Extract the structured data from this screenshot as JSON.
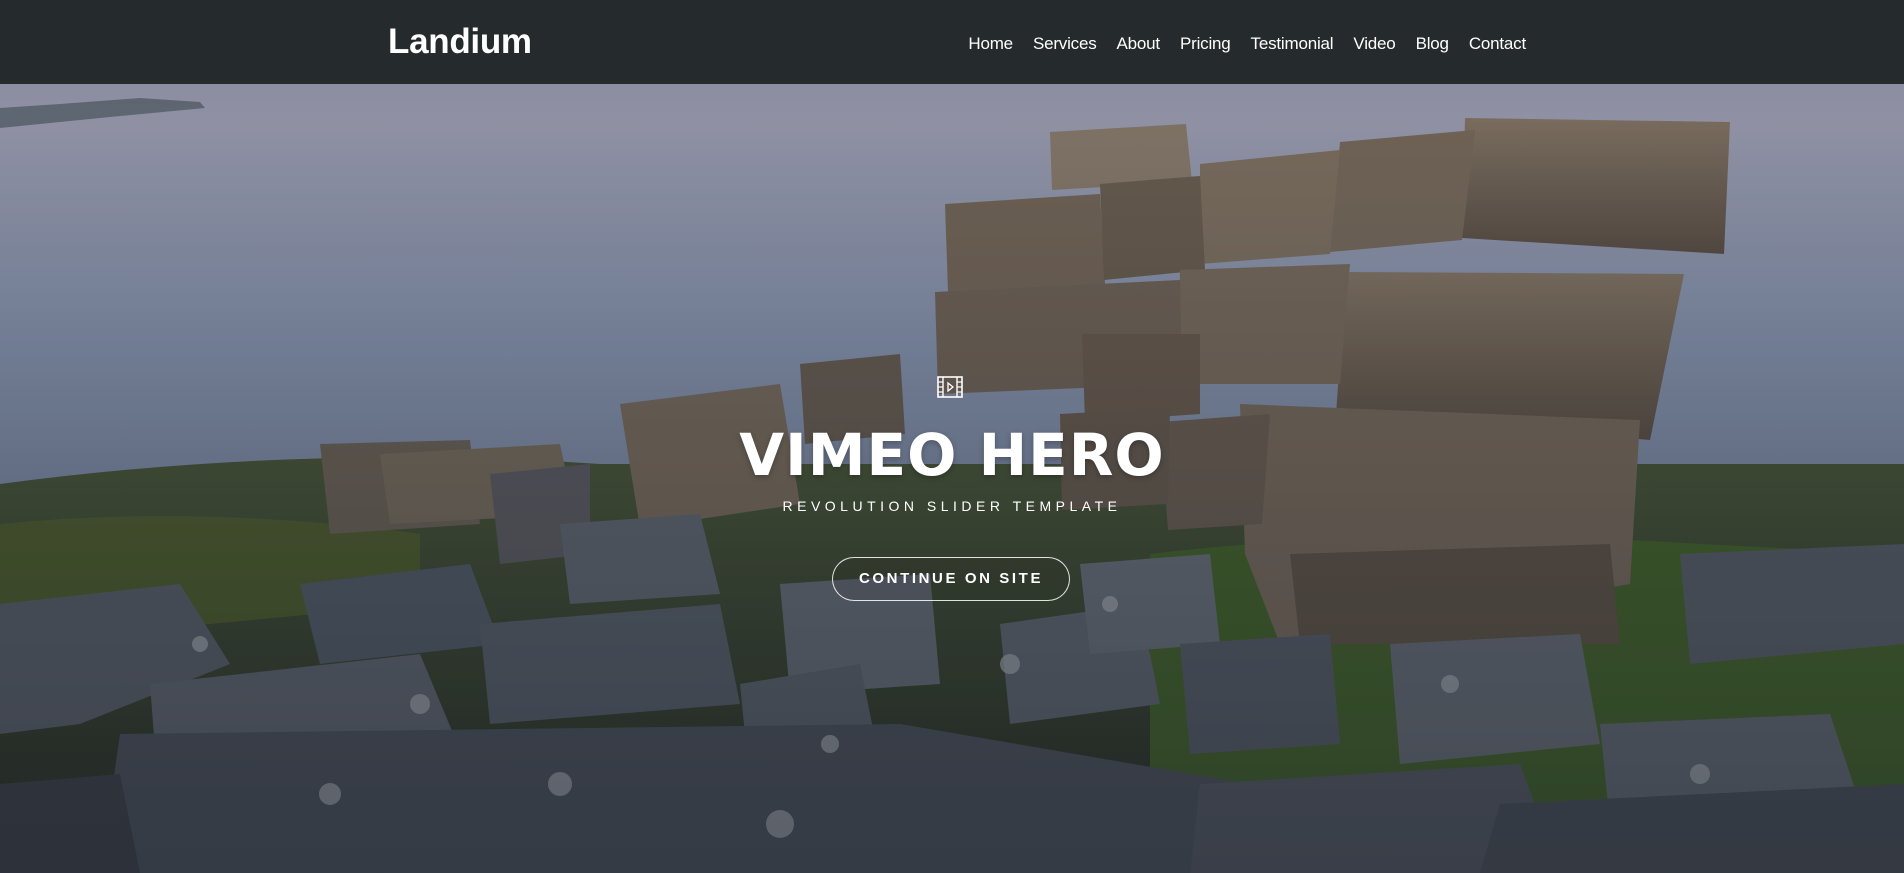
{
  "header": {
    "brand": "Landium",
    "nav": [
      {
        "label": "Home"
      },
      {
        "label": "Services"
      },
      {
        "label": "About"
      },
      {
        "label": "Pricing"
      },
      {
        "label": "Testimonial"
      },
      {
        "label": "Video"
      },
      {
        "label": "Blog"
      },
      {
        "label": "Contact"
      }
    ]
  },
  "hero": {
    "icon": "film-play-icon",
    "title": "VIMEO HERO",
    "subtitle": "REVOLUTION SLIDER TEMPLATE",
    "cta_label": "CONTINUE ON SITE"
  },
  "colors": {
    "navbar_bg": "#252a2d",
    "text": "#ffffff",
    "sky": "#8f9fb8",
    "rock": "#6e6558",
    "grass": "#4f6b2f"
  }
}
